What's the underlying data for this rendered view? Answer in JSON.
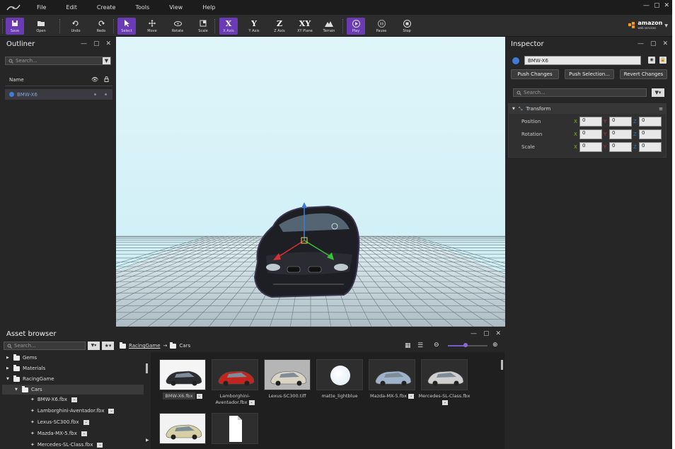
{
  "menu": {
    "items": [
      "File",
      "Edit",
      "Create",
      "Tools",
      "View",
      "Help"
    ]
  },
  "window": {
    "minimize": "—",
    "maximize": "▢",
    "close": "✕"
  },
  "toolbar": {
    "buttons": [
      {
        "label": "Save",
        "active": true
      },
      {
        "label": "Open",
        "active": false
      },
      {
        "label": "Undo",
        "active": false
      },
      {
        "label": "Redo",
        "active": false
      },
      {
        "label": "Select",
        "active": true
      },
      {
        "label": "Move",
        "active": false
      },
      {
        "label": "Rotate",
        "active": false
      },
      {
        "label": "Scale",
        "active": false
      },
      {
        "label": "X Axis",
        "active": true
      },
      {
        "label": "Y Axis",
        "active": false
      },
      {
        "label": "Z Axis",
        "active": false
      },
      {
        "label": "XY Plane",
        "active": false
      },
      {
        "label": "Terrain",
        "active": false
      },
      {
        "label": "Play",
        "active": true
      },
      {
        "label": "Pause",
        "active": false
      },
      {
        "label": "Stop",
        "active": false
      }
    ],
    "axis_glyphs": [
      "X",
      "Y",
      "Z",
      "XY"
    ],
    "aws_brand": "amazon",
    "aws_sub": "web services"
  },
  "outliner": {
    "title": "Outliner",
    "search_placeholder": "Search...",
    "name_header": "Name",
    "items": [
      {
        "label": "BMW-X6",
        "selected": true
      }
    ]
  },
  "inspector": {
    "title": "Inspector",
    "entity_name": "BMW-X6",
    "push_changes": "Push Changes",
    "push_selection": "Push Selection...",
    "revert_changes": "Revert Changes",
    "search_placeholder": "Search...",
    "section": "Transform",
    "rows": [
      {
        "label": "Position",
        "x": "0",
        "y": "0",
        "z": "0"
      },
      {
        "label": "Rotation",
        "x": "0",
        "y": "0",
        "z": "0"
      },
      {
        "label": "Scale",
        "x": "0",
        "y": "0",
        "z": "0"
      }
    ],
    "axes": [
      "X",
      "Y",
      "Z"
    ]
  },
  "assets": {
    "title": "Asset browser",
    "search_placeholder": "Search...",
    "breadcrumb": [
      "RacingGame",
      "Cars"
    ],
    "tree": [
      {
        "label": "Gems",
        "level": 0,
        "expanded": false
      },
      {
        "label": "Materials",
        "level": 0,
        "expanded": false
      },
      {
        "label": "RacingGame",
        "level": 0,
        "expanded": true
      },
      {
        "label": "Cars",
        "level": 1,
        "expanded": true,
        "selected": true
      }
    ],
    "tree_files": [
      "BMW-X6.fbx",
      "Lamborghini-Aventador.fbx",
      "Lexus-SC300.fbx",
      "Mazda-MX-5.fbx",
      "Mercedes-SL-Class.fbx"
    ],
    "thumbs": [
      {
        "label": "BMW-X6.fbx",
        "selected": true,
        "badge": true,
        "color": "#2a2c30"
      },
      {
        "label": "Lamborghini-Aventador.fbx",
        "badge": true,
        "color": "#c2241e"
      },
      {
        "label": "Lexus-SC300.tiff",
        "badge": false,
        "color": "#d9d4c4"
      },
      {
        "label": "matte_lightblue",
        "badge": false,
        "color": "#dfeaf7"
      },
      {
        "label": "Mazda-MX-5.fbx",
        "badge": true,
        "color": "#9fb3cc"
      },
      {
        "label": "Mercedes-SL-Class.fbx",
        "badge": true,
        "color": "#cfcfcf"
      }
    ],
    "row2_thumbs": [
      {
        "color": "#d7d0a4"
      },
      {
        "color": "#ffffff"
      }
    ],
    "zoom_fraction": 0.45
  },
  "colors": {
    "accent": "#6a3bb4",
    "selection": "#3d6db5"
  }
}
